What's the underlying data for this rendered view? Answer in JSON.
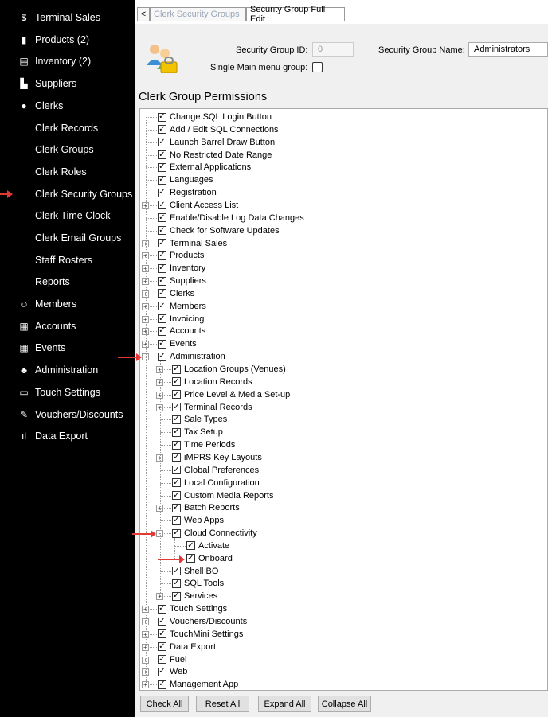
{
  "sidebar": {
    "items": [
      {
        "label": "Terminal Sales",
        "icon": "dollar-icon",
        "glyph": "$"
      },
      {
        "label": "Products (2)",
        "icon": "bottles-icon",
        "glyph": "▮"
      },
      {
        "label": "Inventory (2)",
        "icon": "inventory-icon",
        "glyph": "▤"
      },
      {
        "label": "Suppliers",
        "icon": "truck-icon",
        "glyph": "▙"
      },
      {
        "label": "Clerks",
        "icon": "person-icon",
        "glyph": "●"
      }
    ],
    "clerk_sub": [
      "Clerk Records",
      "Clerk Groups",
      "Clerk Roles",
      "Clerk Security Groups",
      "Clerk Time Clock",
      "Clerk Email Groups",
      "Staff Rosters",
      "Reports"
    ],
    "items2": [
      {
        "label": "Members",
        "icon": "member-icon",
        "glyph": "☺"
      },
      {
        "label": "Accounts",
        "icon": "accounts-icon",
        "glyph": "▦"
      },
      {
        "label": "Events",
        "icon": "calendar-icon",
        "glyph": "▦"
      },
      {
        "label": "Administration",
        "icon": "admin-icon",
        "glyph": "♣"
      },
      {
        "label": "Touch Settings",
        "icon": "monitor-icon",
        "glyph": "▭"
      },
      {
        "label": "Vouchers/Discounts",
        "icon": "voucher-icon",
        "glyph": "✎"
      },
      {
        "label": "Data Export",
        "icon": "export-icon",
        "glyph": "ıl"
      }
    ]
  },
  "tabs": {
    "back": "<",
    "tab1": "Clerk Security Groups",
    "tab2": "Security Group Full Edit"
  },
  "header": {
    "id_label": "Security Group ID:",
    "id_value": "0",
    "name_label": "Security Group Name:",
    "name_value": "Administrators",
    "single_label": "Single Main menu group:"
  },
  "permissions_title": "Clerk Group Permissions",
  "tree": [
    {
      "label": "Change SQL Login Button",
      "level": 0,
      "exp": ""
    },
    {
      "label": "Add / Edit SQL Connections",
      "level": 0,
      "exp": ""
    },
    {
      "label": "Launch Barrel Draw Button",
      "level": 0,
      "exp": ""
    },
    {
      "label": "No Restricted Date Range",
      "level": 0,
      "exp": ""
    },
    {
      "label": "External Applications",
      "level": 0,
      "exp": ""
    },
    {
      "label": "Languages",
      "level": 0,
      "exp": ""
    },
    {
      "label": "Registration",
      "level": 0,
      "exp": ""
    },
    {
      "label": "Client Access List",
      "level": 0,
      "exp": "+"
    },
    {
      "label": "Enable/Disable Log Data Changes",
      "level": 0,
      "exp": ""
    },
    {
      "label": "Check for Software Updates",
      "level": 0,
      "exp": ""
    },
    {
      "label": "Terminal Sales",
      "level": 0,
      "exp": "+"
    },
    {
      "label": "Products",
      "level": 0,
      "exp": "+"
    },
    {
      "label": "Inventory",
      "level": 0,
      "exp": "+"
    },
    {
      "label": "Suppliers",
      "level": 0,
      "exp": "+"
    },
    {
      "label": "Clerks",
      "level": 0,
      "exp": "+"
    },
    {
      "label": "Members",
      "level": 0,
      "exp": "+"
    },
    {
      "label": "Invoicing",
      "level": 0,
      "exp": "+"
    },
    {
      "label": "Accounts",
      "level": 0,
      "exp": "+"
    },
    {
      "label": "Events",
      "level": 0,
      "exp": "+"
    },
    {
      "label": "Administration",
      "level": 0,
      "exp": "-"
    },
    {
      "label": "Location Groups (Venues)",
      "level": 1,
      "exp": "+"
    },
    {
      "label": "Location Records",
      "level": 1,
      "exp": "+"
    },
    {
      "label": "Price Level & Media Set-up",
      "level": 1,
      "exp": "+"
    },
    {
      "label": "Terminal Records",
      "level": 1,
      "exp": "+"
    },
    {
      "label": "Sale Types",
      "level": 1,
      "exp": ""
    },
    {
      "label": "Tax Setup",
      "level": 1,
      "exp": ""
    },
    {
      "label": "Time Periods",
      "level": 1,
      "exp": ""
    },
    {
      "label": "iMPRS Key Layouts",
      "level": 1,
      "exp": "+"
    },
    {
      "label": "Global Preferences",
      "level": 1,
      "exp": ""
    },
    {
      "label": "Local Configuration",
      "level": 1,
      "exp": ""
    },
    {
      "label": "Custom Media Reports",
      "level": 1,
      "exp": ""
    },
    {
      "label": "Batch Reports",
      "level": 1,
      "exp": "+"
    },
    {
      "label": "Web Apps",
      "level": 1,
      "exp": ""
    },
    {
      "label": "Cloud Connectivity",
      "level": 1,
      "exp": "-"
    },
    {
      "label": "Activate",
      "level": 2,
      "exp": ""
    },
    {
      "label": "Onboard",
      "level": 2,
      "exp": ""
    },
    {
      "label": "Shell BO",
      "level": 1,
      "exp": ""
    },
    {
      "label": "SQL Tools",
      "level": 1,
      "exp": ""
    },
    {
      "label": "Services",
      "level": 1,
      "exp": "+"
    },
    {
      "label": "Touch Settings",
      "level": 0,
      "exp": "+"
    },
    {
      "label": "Vouchers/Discounts",
      "level": 0,
      "exp": "+"
    },
    {
      "label": "TouchMini Settings",
      "level": 0,
      "exp": "+"
    },
    {
      "label": "Data Export",
      "level": 0,
      "exp": "+"
    },
    {
      "label": "Fuel",
      "level": 0,
      "exp": "+"
    },
    {
      "label": "Web",
      "level": 0,
      "exp": "+"
    },
    {
      "label": "Management App",
      "level": 0,
      "exp": "+"
    }
  ],
  "buttons": {
    "check_all": "Check All",
    "reset_all": "Reset All",
    "expand_all": "Expand All",
    "collapse_all": "Collapse All"
  },
  "colors": {
    "arrow": "#e53935",
    "sidebar_bg": "#000000",
    "panel_bg": "#f0f0f0"
  }
}
